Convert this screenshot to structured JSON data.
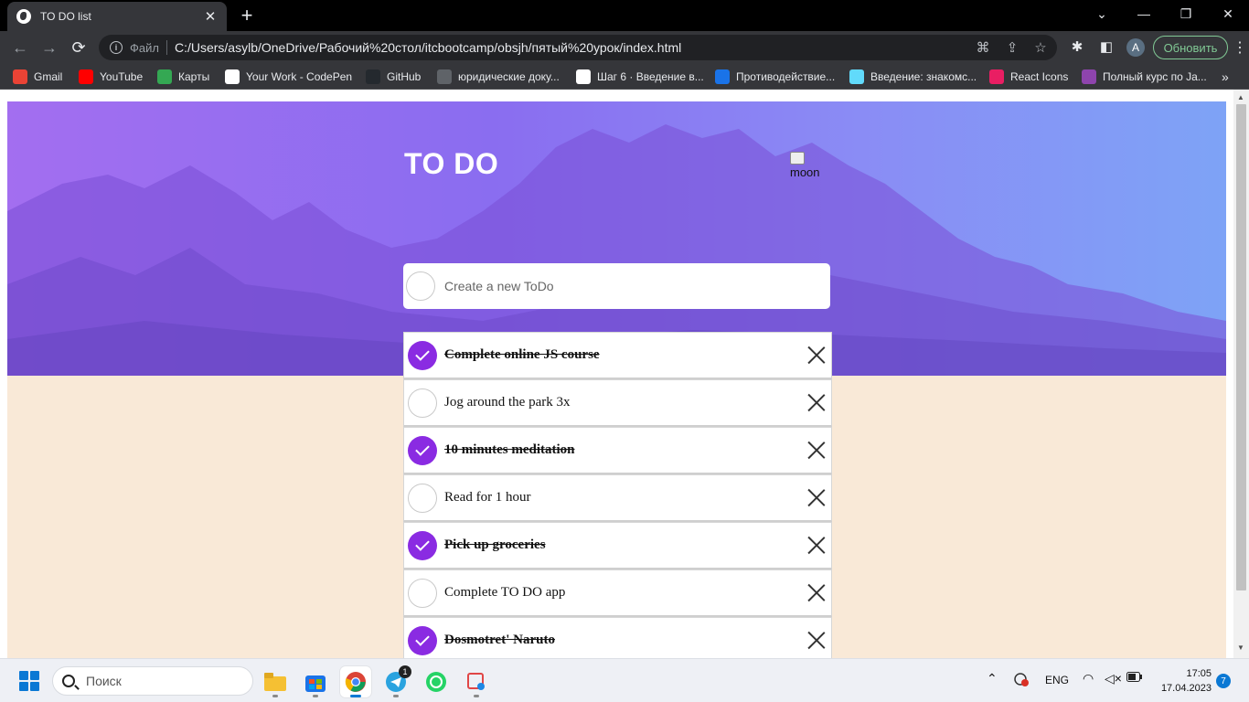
{
  "browser": {
    "tab_title": "TO DO list",
    "tab_close": "✕",
    "new_tab": "+",
    "window_controls": {
      "minimize": "—",
      "maximize": "❐",
      "close": "✕",
      "tab_search": "⌄"
    },
    "address": {
      "scheme_label": "Файл",
      "url": "C:/Users/asylb/OneDrive/Рабочий%20стол/itcbootcamp/obsjh/пятый%20урок/index.html"
    },
    "profile_initial": "A",
    "update_label": "Обновить",
    "bookmarks": [
      {
        "label": "Gmail",
        "icon": "google-icon",
        "color": "#ea4335"
      },
      {
        "label": "YouTube",
        "icon": "youtube-icon",
        "color": "#ff0000"
      },
      {
        "label": "Карты",
        "icon": "maps-icon",
        "color": "#34a853"
      },
      {
        "label": "Your Work - CodePen",
        "icon": "codepen-icon",
        "color": "#ffffff"
      },
      {
        "label": "GitHub",
        "icon": "github-icon",
        "color": "#24292e"
      },
      {
        "label": "юридические доку...",
        "icon": "doc-icon",
        "color": "#5f6368"
      },
      {
        "label": "Шаг 6 · Введение в...",
        "icon": "stepik-icon",
        "color": "#ffffff"
      },
      {
        "label": "Противодействие...",
        "icon": "c-icon",
        "color": "#1a73e8"
      },
      {
        "label": "Введение: знакомс...",
        "icon": "react-icon",
        "color": "#61dafb"
      },
      {
        "label": "React Icons",
        "icon": "react-icons-icon",
        "color": "#e91e63"
      },
      {
        "label": "Полный курс по Ja...",
        "icon": "course-icon",
        "color": "#8e44ad"
      }
    ],
    "bookmarks_more": "»"
  },
  "app": {
    "title": "TO DO",
    "theme_toggle_alt": "moon",
    "new_todo_placeholder": "Create a new ToDo",
    "accent_color": "#8a2be2",
    "todos": [
      {
        "text": "Complete online JS course",
        "done": true
      },
      {
        "text": "Jog around the park 3x",
        "done": false
      },
      {
        "text": "10 minutes meditation",
        "done": true
      },
      {
        "text": "Read for 1 hour",
        "done": false
      },
      {
        "text": "Pick up groceries",
        "done": true
      },
      {
        "text": "Complete TO DO app",
        "done": false
      },
      {
        "text": "Dosmotret' Naruto",
        "done": true
      }
    ]
  },
  "taskbar": {
    "search_placeholder": "Поиск",
    "telegram_badge": "1",
    "language": "ENG",
    "time": "17:05",
    "date": "17.04.2023",
    "notifications": "7"
  }
}
